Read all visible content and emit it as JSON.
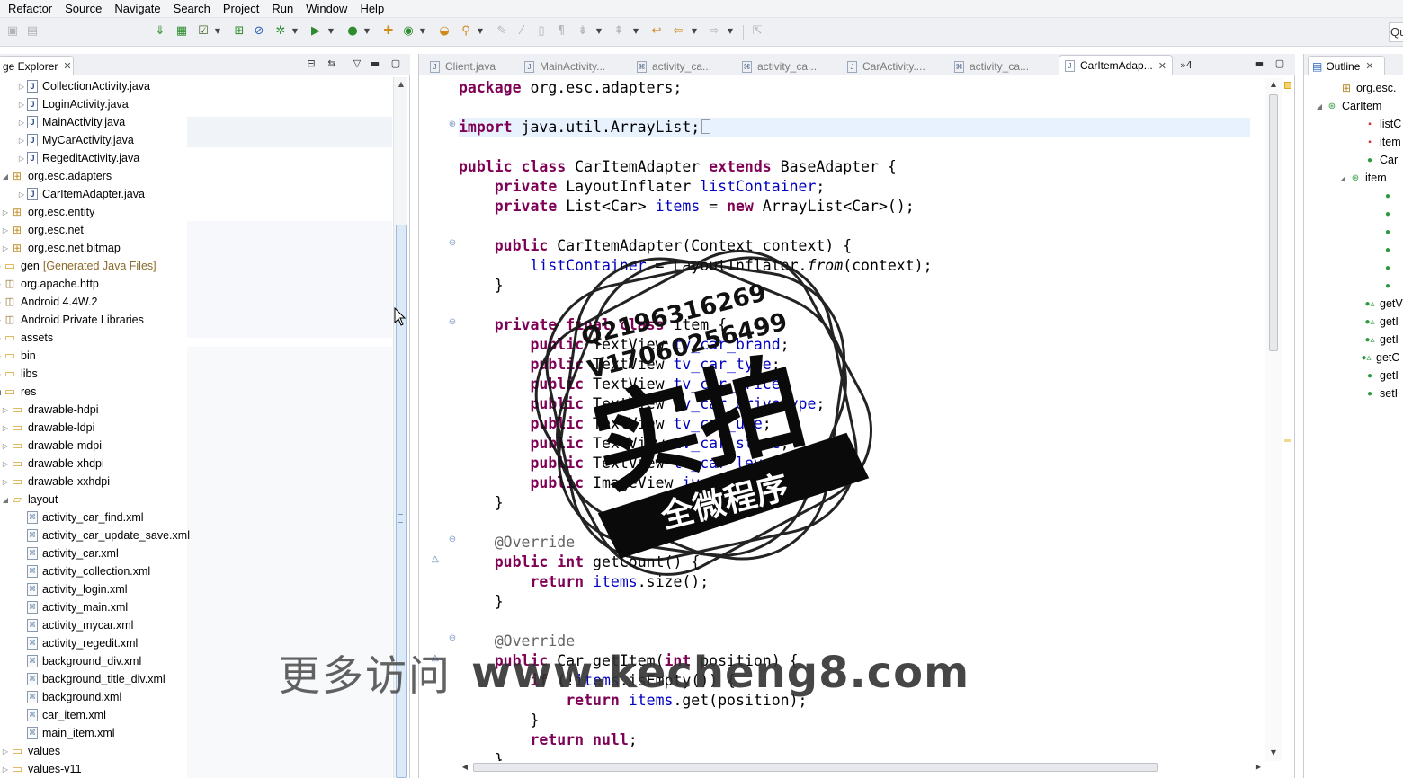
{
  "menu": [
    "Refactor",
    "Source",
    "Navigate",
    "Search",
    "Project",
    "Run",
    "Window",
    "Help"
  ],
  "quick_access_label": "Qu",
  "left_view": {
    "tab_label": "ge Explorer",
    "tree": [
      {
        "label": "CollectionActivity.java",
        "icon": "java-file-icon"
      },
      {
        "label": "LoginActivity.java",
        "icon": "java-file-icon"
      },
      {
        "label": "MainActivity.java",
        "icon": "java-file-icon"
      },
      {
        "label": "MyCarActivity.java",
        "icon": "java-file-icon"
      },
      {
        "label": "RegeditActivity.java",
        "icon": "java-file-icon"
      },
      {
        "label": "org.esc.adapters",
        "icon": "package-icon"
      },
      {
        "label": "CarItemAdapter.java",
        "icon": "java-file-icon"
      },
      {
        "label": "org.esc.entity",
        "icon": "package-icon"
      },
      {
        "label": "org.esc.net",
        "icon": "package-icon"
      },
      {
        "label": "org.esc.net.bitmap",
        "icon": "package-icon"
      },
      {
        "label": "gen",
        "decor": "[Generated Java Files]",
        "icon": "folder-icon"
      },
      {
        "label": "org.apache.http",
        "icon": "library-icon"
      },
      {
        "label": "Android 4.4W.2",
        "icon": "library-icon"
      },
      {
        "label": "Android Private Libraries",
        "icon": "library-icon"
      },
      {
        "label": "assets",
        "icon": "folder-icon"
      },
      {
        "label": "bin",
        "icon": "folder-icon"
      },
      {
        "label": "libs",
        "icon": "folder-icon"
      },
      {
        "label": "res",
        "icon": "folder-icon"
      },
      {
        "label": "drawable-hdpi",
        "icon": "folder-icon"
      },
      {
        "label": "drawable-ldpi",
        "icon": "folder-icon"
      },
      {
        "label": "drawable-mdpi",
        "icon": "folder-icon"
      },
      {
        "label": "drawable-xhdpi",
        "icon": "folder-icon"
      },
      {
        "label": "drawable-xxhdpi",
        "icon": "folder-icon"
      },
      {
        "label": "layout",
        "icon": "folder-open-icon"
      },
      {
        "label": "activity_car_find.xml",
        "icon": "xml-file-icon"
      },
      {
        "label": "activity_car_update_save.xml",
        "icon": "xml-file-icon"
      },
      {
        "label": "activity_car.xml",
        "icon": "xml-file-icon"
      },
      {
        "label": "activity_collection.xml",
        "icon": "xml-file-icon"
      },
      {
        "label": "activity_login.xml",
        "icon": "xml-file-icon"
      },
      {
        "label": "activity_main.xml",
        "icon": "xml-file-icon"
      },
      {
        "label": "activity_mycar.xml",
        "icon": "xml-file-icon"
      },
      {
        "label": "activity_regedit.xml",
        "icon": "xml-file-icon"
      },
      {
        "label": "background_div.xml",
        "icon": "xml-file-icon"
      },
      {
        "label": "background_title_div.xml",
        "icon": "xml-file-icon"
      },
      {
        "label": "background.xml",
        "icon": "xml-file-icon"
      },
      {
        "label": "car_item.xml",
        "icon": "xml-file-icon"
      },
      {
        "label": "main_item.xml",
        "icon": "xml-file-icon"
      },
      {
        "label": "values",
        "icon": "folder-icon"
      },
      {
        "label": "values-v11",
        "icon": "folder-icon"
      }
    ]
  },
  "editor": {
    "tabs": [
      "Client.java",
      "MainActivity...",
      "activity_ca...",
      "activity_ca...",
      "CarActivity....",
      "activity_ca...",
      "CarItemAdap..."
    ],
    "overflow_count": "4",
    "code_lines": [
      "package org.esc.adapters;",
      "",
      "import java.util.ArrayList;",
      "",
      "public class CarItemAdapter extends BaseAdapter {",
      "    private LayoutInflater listContainer;",
      "    private List<Car> items = new ArrayList<Car>();",
      "",
      "    public CarItemAdapter(Context context) {",
      "        listContainer = LayoutInflater.from(context);",
      "    }",
      "",
      "    private final class item {",
      "        public TextView tv_car_brand;",
      "        public TextView tv_car_type;",
      "        public TextView tv_car_price;",
      "        public TextView tv_car_drivetype;",
      "        public TextView tv_car_use;",
      "        public TextView tv_car_state;",
      "        public TextView tv_car_level;",
      "        public ImageView iv_car;",
      "    }",
      "",
      "    @Override",
      "    public int getCount() {",
      "        return items.size();",
      "    }",
      "",
      "    @Override",
      "    public Car getItem(int position) {",
      "        if (!items.isEmpty()) {",
      "            return items.get(position);",
      "        }",
      "        return null;",
      "    }"
    ]
  },
  "outline": {
    "tab_label": "Outline",
    "items": [
      "org.esc.",
      "CarItem",
      "listC",
      "item",
      "Car",
      "item",
      "",
      "",
      "",
      "",
      "",
      "",
      "getV",
      "getI",
      "getI",
      "getC",
      "getI",
      "setI"
    ]
  },
  "overlays": {
    "stamp_phone_1": "Q2196316269",
    "stamp_phone_2": "V17060256499",
    "stamp_big": "实拍",
    "stamp_banner": "全微程序",
    "watermark_prefix": "更多访问",
    "watermark_url": "www.kecheng8.com"
  },
  "colors": {
    "keyword": "#7f0055",
    "field": "#0000c0",
    "annotation": "#646464",
    "current_line": "#e8f2fe",
    "selection_thumb": "#dce9f6"
  }
}
